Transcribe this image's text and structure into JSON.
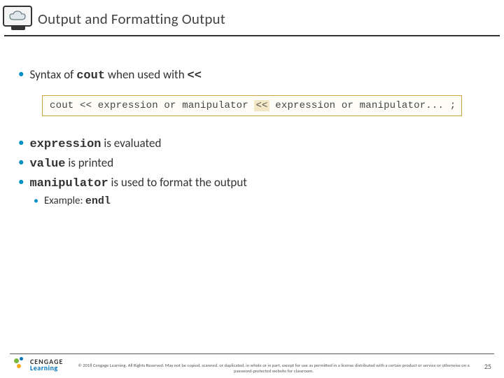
{
  "header": {
    "title": "Output and Formatting Output"
  },
  "bullets": {
    "b1_pre": "Syntax of ",
    "b1_code": "cout",
    "b1_mid": " when used with ",
    "b1_op": "<<",
    "b2_code": "expression",
    "b2_text": " is evaluated",
    "b3_code": "value",
    "b3_text": " is printed",
    "b4_code": "manipulator",
    "b4_text": " is used to format the output",
    "ex_pre": "Example: ",
    "ex_code": "endl"
  },
  "codebox": {
    "p1": "cout << expression or manipulator ",
    "p2": "<<",
    "p3": " expression or manipulator... ;"
  },
  "footer": {
    "brand_top": "CENGAGE",
    "brand_bottom": "Learning",
    "copyright": "© 2018 Cengage Learning. All Rights Reserved. May not be copied, scanned, or duplicated, in whole or in part, except for use as permitted in a license distributed with a certain product or service or otherwise on a password-protected website for classroom.",
    "page": "25"
  }
}
